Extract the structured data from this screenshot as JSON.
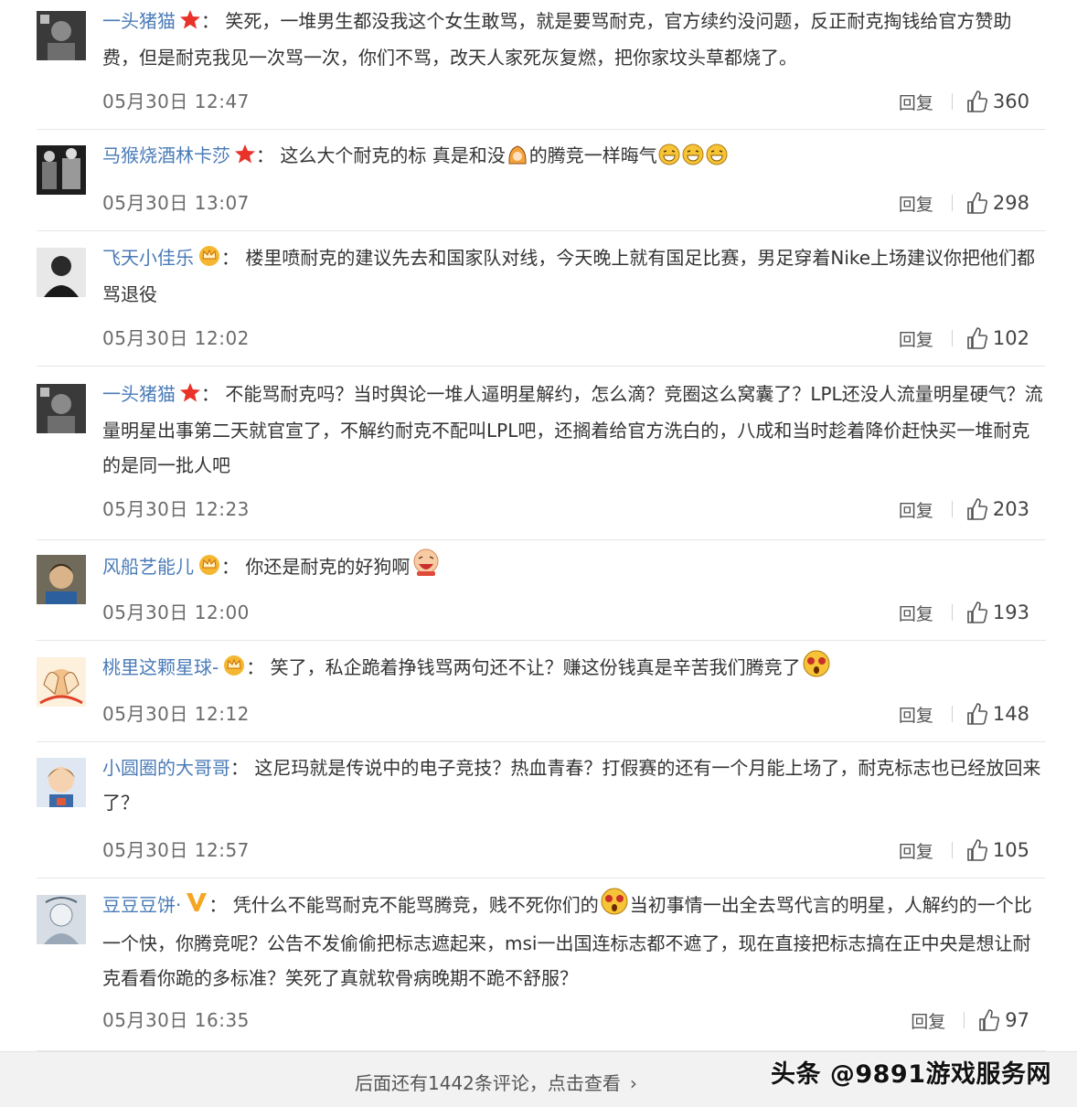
{
  "comments": [
    {
      "username": "一头猪猫",
      "badge": "star",
      "text": "：  笑死，一堆男生都没我这个女生敢骂，就是要骂耐克，官方续约没问题，反正耐克掏钱给官方赞助费，但是耐克我见一次骂一次，你们不骂，改天人家死灰复燃，把你家坟头草都烧了。",
      "time": "05月30日 12:47",
      "reply_label": "回复",
      "likes": "360"
    },
    {
      "username": "马猴烧酒林卡莎",
      "badge": "star",
      "text_parts": [
        "：  这么大个耐克的标 真是和没",
        "的腾竞一样晦气"
      ],
      "time": "05月30日 13:07",
      "reply_label": "回复",
      "likes": "298"
    },
    {
      "username": "飞天小佳乐",
      "badge": "crown",
      "text": "：  楼里喷耐克的建议先去和国家队对线，今天晚上就有国足比赛，男足穿着Nike上场建议你把他们都骂退役",
      "time": "05月30日 12:02",
      "reply_label": "回复",
      "likes": "102"
    },
    {
      "username": "一头猪猫",
      "badge": "star",
      "text": "：  不能骂耐克吗？当时舆论一堆人逼明星解约，怎么滴？竞圈这么窝囊了？LPL还没人流量明星硬气？流量明星出事第二天就官宣了，不解约耐克不配叫LPL吧，还搁着给官方洗白的，八成和当时趁着降价赶快买一堆耐克的是同一批人吧",
      "time": "05月30日 12:23",
      "reply_label": "回复",
      "likes": "203"
    },
    {
      "username": "风船艺能儿",
      "badge": "crown",
      "text": "：  你还是耐克的好狗啊",
      "time": "05月30日 12:00",
      "reply_label": "回复",
      "likes": "193"
    },
    {
      "username": "桃里这颗星球-",
      "badge": "crown",
      "text": "：  笑了，私企跪着挣钱骂两句还不让？赚这份钱真是辛苦我们腾竞了",
      "time": "05月30日 12:12",
      "reply_label": "回复",
      "likes": "148"
    },
    {
      "username": "小圆圈的大哥哥",
      "badge": "",
      "text": "：  这尼玛就是传说中的电子竞技？热血青春？打假赛的还有一个月能上场了，耐克标志也已经放回来了？",
      "time": "05月30日 12:57",
      "reply_label": "回复",
      "likes": "105"
    },
    {
      "username": "豆豆豆饼·",
      "badge": "vip",
      "text_parts": [
        "：  凭什么不能骂耐克不能骂腾竞，贱不死你们的",
        "当初事情一出全去骂代言的明星，人解约的一个比一个快，你腾竞呢？公告不发偷偷把标志遮起来，msi一出国连标志都不遮了，现在直接把标志搞在正中央是想让耐克看看你跪的多标准？笑死了真就软骨病晚期不跪不舒服？"
      ],
      "time": "05月30日 16:35",
      "reply_label": "回复",
      "likes": "97"
    }
  ],
  "footer": {
    "more_label": "后面还有1442条评论，点击查看"
  },
  "watermark": "头条 @9891游戏服务网"
}
